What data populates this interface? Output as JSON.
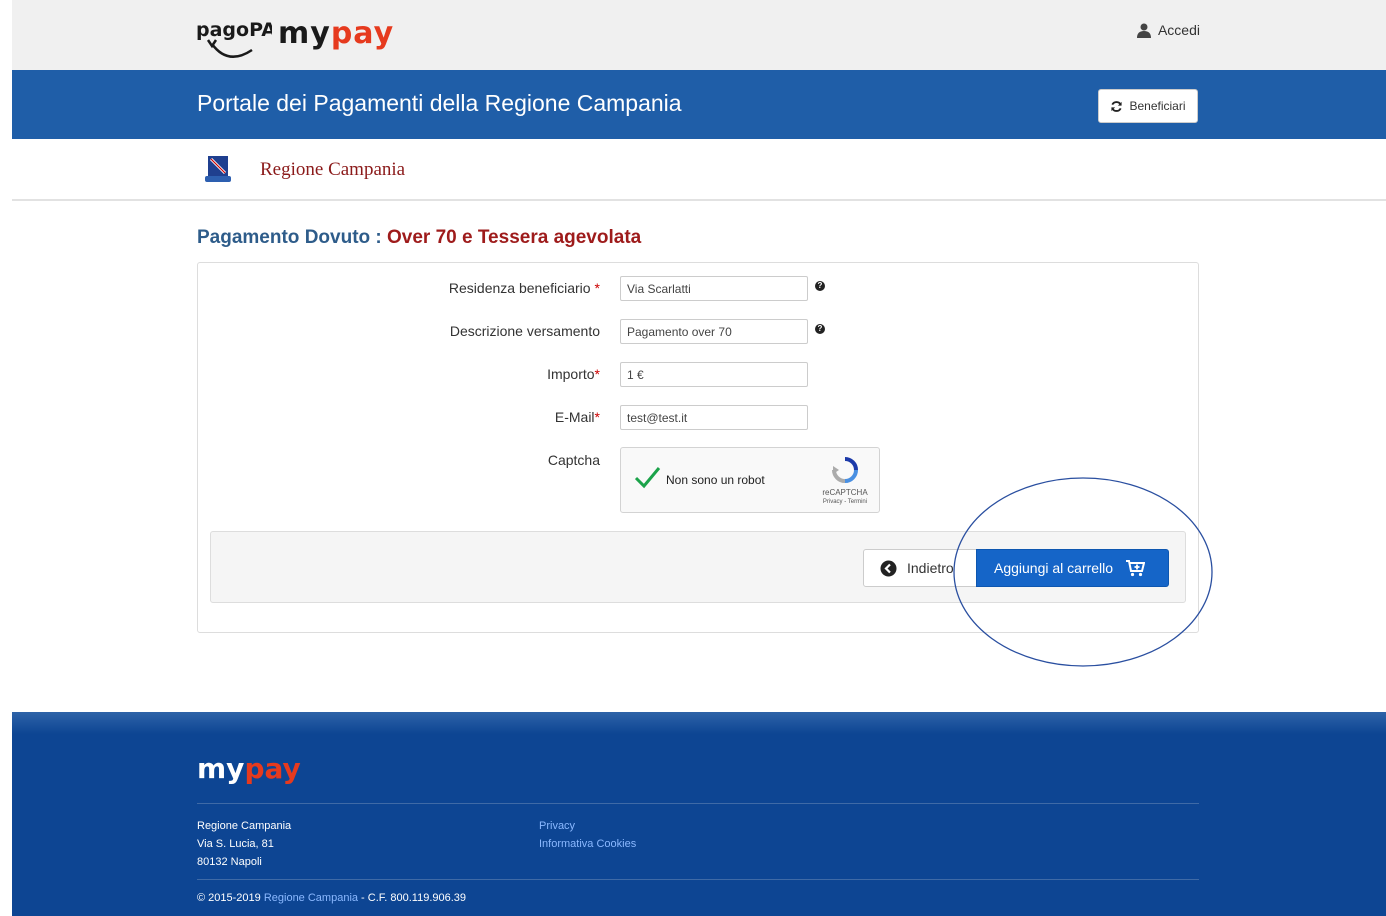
{
  "topbar": {
    "logo_pagopa": "pagoPA",
    "logo_mypay_m": "my",
    "logo_mypay_p": "pay",
    "login_label": "Accedi"
  },
  "header": {
    "title": "Portale dei Pagamenti della Regione Campania",
    "beneficiari_label": "Beneficiari"
  },
  "entity": {
    "name": "Regione Campania"
  },
  "page": {
    "heading_prefix": "Pagamento Dovuto :",
    "heading_title": "Over 70 e Tessera agevolata"
  },
  "form": {
    "fields": [
      {
        "label": "Residenza beneficiario",
        "required": "*",
        "value": "Via Scarlatti",
        "help": "?"
      },
      {
        "label": "Descrizione versamento",
        "required": "",
        "value": "Pagamento over 70",
        "help": "?"
      },
      {
        "label": "Importo",
        "required": "*",
        "value": "1 €"
      },
      {
        "label": "E-Mail",
        "required": "*",
        "value": "test@test.it"
      }
    ],
    "captcha_label": "Captcha",
    "captcha": {
      "text": "Non sono un robot",
      "brand": "reCAPTCHA",
      "links": "Privacy - Termini"
    }
  },
  "actions": {
    "back_label": "Indietro",
    "cart_label": "Aggiungi al carrello"
  },
  "footer": {
    "logo_m": "my",
    "logo_p": "pay",
    "address": [
      "Regione Campania",
      "Via S. Lucia, 81",
      "80132 Napoli"
    ],
    "links": [
      "Privacy",
      "Informativa Cookies"
    ],
    "copyright_prefix": "© 2015-2019 ",
    "copyright_link": "Regione Campania",
    "copyright_suffix": " - C.F. 800.119.906.39"
  },
  "colors": {
    "header_blue": "#1f5ea8",
    "footer_blue": "#0d4593",
    "heading_red": "#9e1b1b",
    "button_blue": "#1565c8",
    "mypay_accent": "#e63a1e"
  }
}
